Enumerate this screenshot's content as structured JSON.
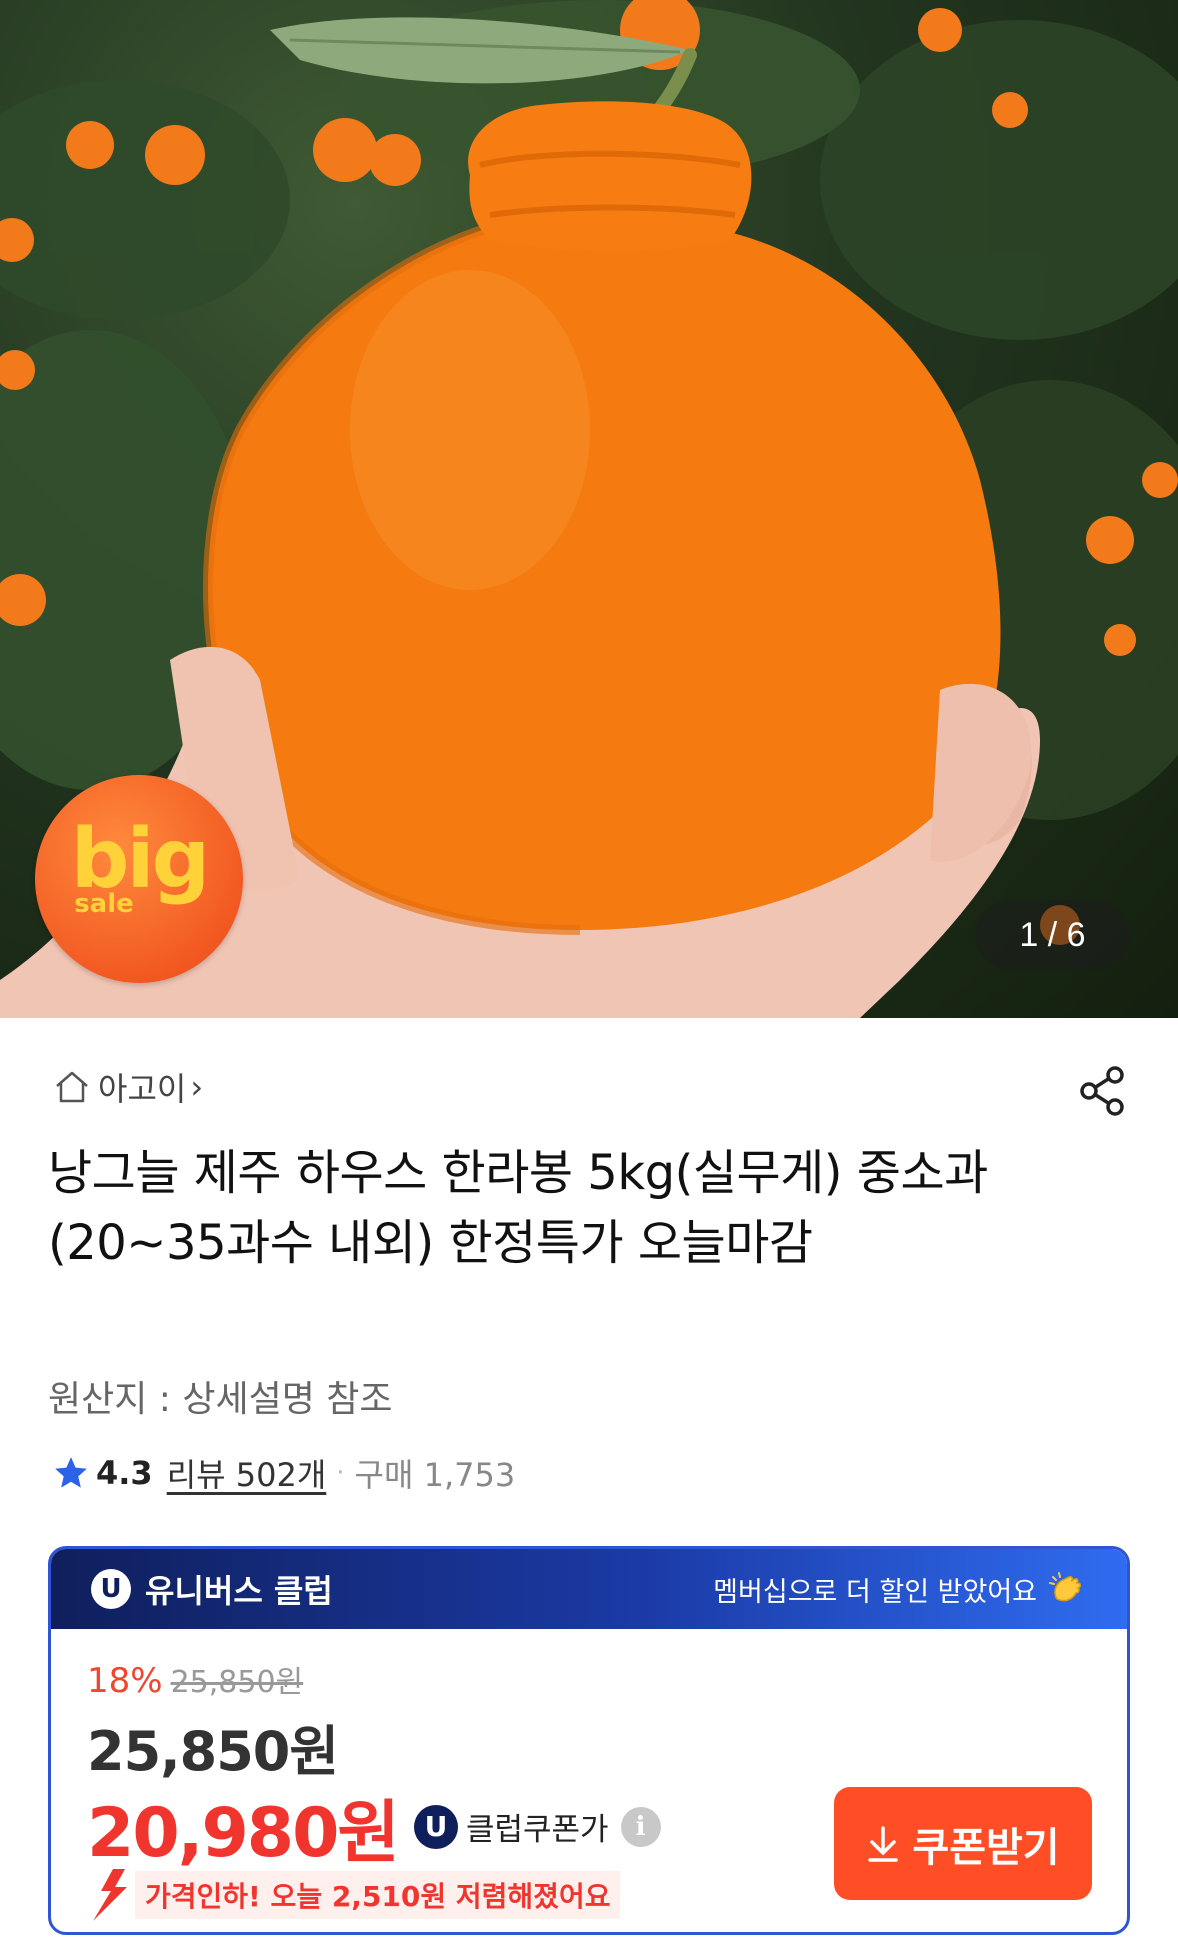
{
  "hero": {
    "badge_big": "big",
    "badge_sale": "sale",
    "pager": "1 / 6"
  },
  "store": {
    "name": "아고이",
    "chevron": "›"
  },
  "product": {
    "title": "낭그늘 제주 하우스 한라봉 5kg(실무게) 중소과(20~35과수 내외) 한정특가 오늘마감",
    "origin": "원산지 : 상세설명 참조",
    "rating": "4.3",
    "reviews": "리뷰 502개",
    "separator": "·",
    "sold": "구매 1,753"
  },
  "club": {
    "badge": "U",
    "name": "유니버스 클럽",
    "message": "멤버십으로 더 할인 받았어요",
    "discount_pct": "18%",
    "original_price": "25,850원",
    "price": "25,850원",
    "club_price": "20,980원",
    "coupon_label": "클럽쿠폰가",
    "info": "i",
    "price_drop": "가격인하! 오늘 2,510원 저렴해졌어요",
    "coupon_button": "쿠폰받기"
  },
  "colors": {
    "accent_red": "#f0352e",
    "button_orange": "#ff4e26",
    "club_navy": "#0f1f5c",
    "club_blue": "#2f55d4"
  }
}
